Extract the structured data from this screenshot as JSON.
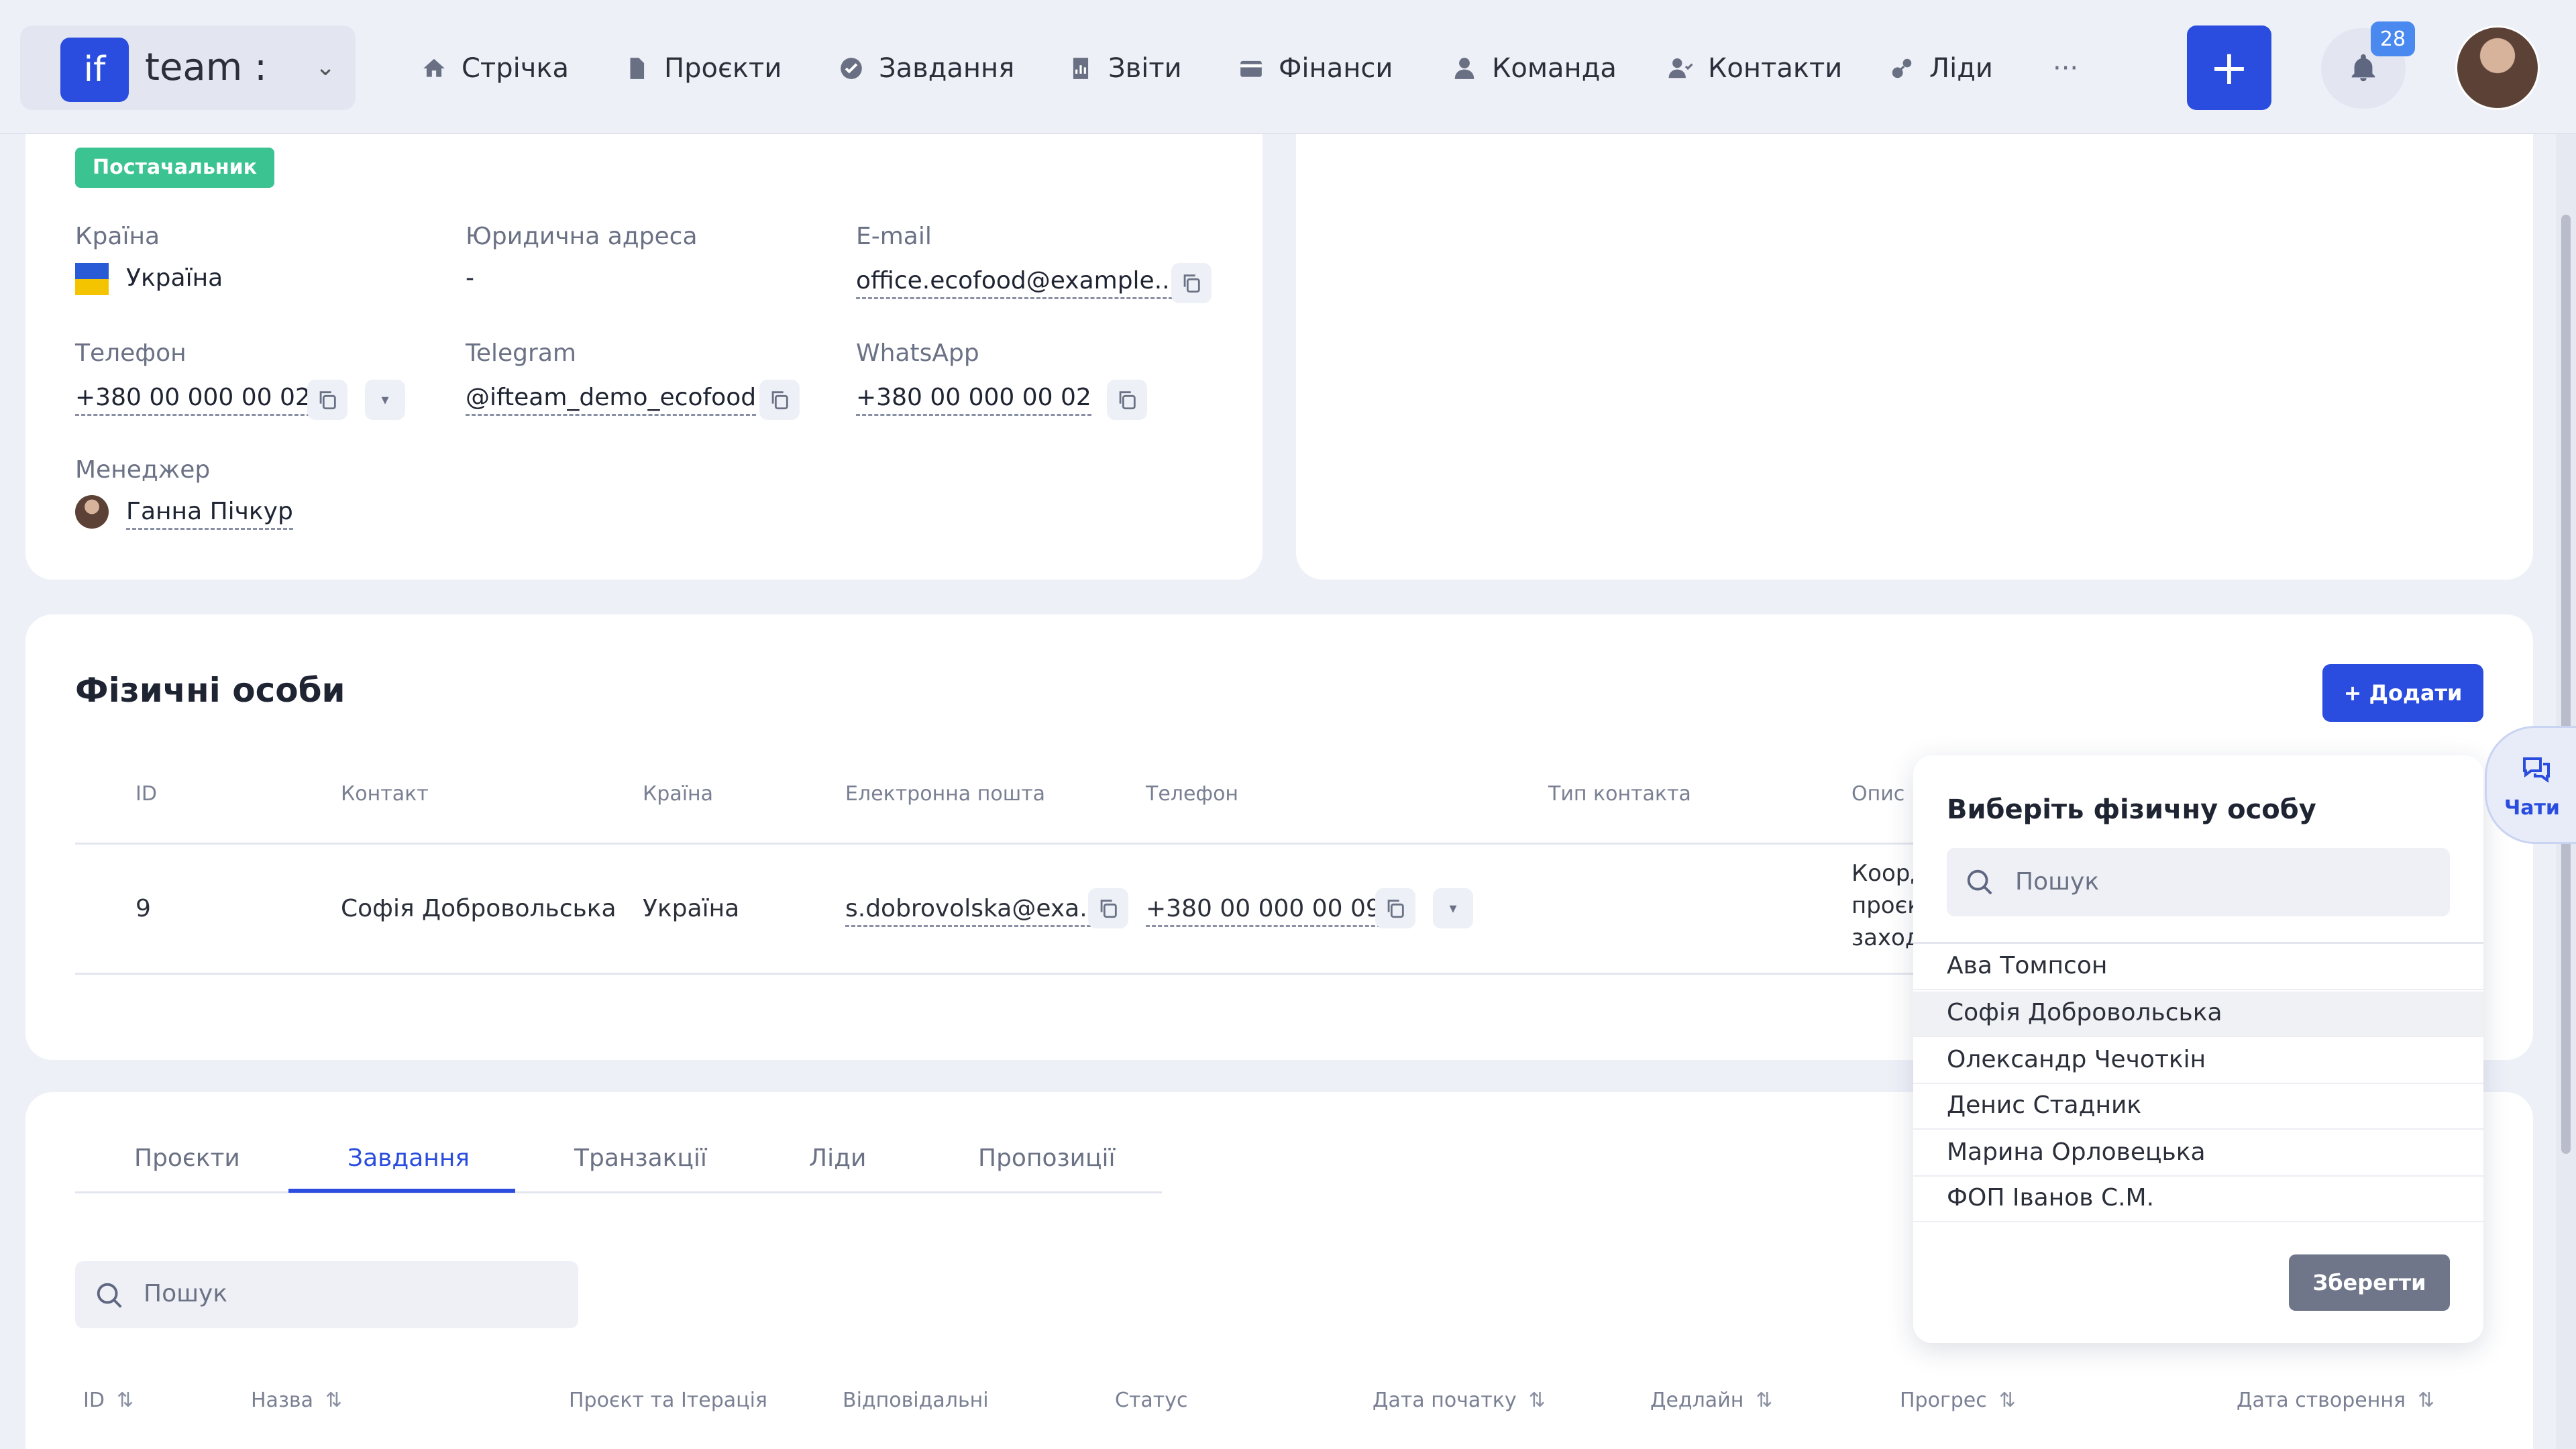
{
  "header": {
    "logo_mark": "if",
    "logo_text": "team :",
    "nav": [
      {
        "label": "Стрічка",
        "icon": "home-icon"
      },
      {
        "label": "Проєкти",
        "icon": "document-icon"
      },
      {
        "label": "Завдання",
        "icon": "check-circle-icon"
      },
      {
        "label": "Звіти",
        "icon": "report-icon"
      },
      {
        "label": "Фінанси",
        "icon": "wallet-icon"
      },
      {
        "label": "Команда",
        "icon": "user-icon"
      },
      {
        "label": "Контакти",
        "icon": "contacts-icon"
      },
      {
        "label": "Ліди",
        "icon": "leads-icon"
      }
    ],
    "more_label": "···",
    "add_label": "+",
    "notifications_count": "28"
  },
  "company": {
    "badge": "Постачальник",
    "country_label": "Країна",
    "country_value": "Україна",
    "legal_address_label": "Юридична адреса",
    "legal_address_value": "-",
    "email_label": "E-mail",
    "email_value": "office.ecofood@example....",
    "phone_label": "Телефон",
    "phone_value": "+380 00 000 00 02",
    "telegram_label": "Telegram",
    "telegram_value": "@ifteam_demo_ecofood",
    "whatsapp_label": "WhatsApp",
    "whatsapp_value": "+380 00 000 00 02",
    "manager_label": "Менеджер",
    "manager_value": "Ганна Пічкур"
  },
  "persons": {
    "title": "Фізичні особи",
    "add_button": "+ Додати",
    "columns": [
      "ID",
      "Контакт",
      "Країна",
      "Електронна пошта",
      "Телефон",
      "Тип контакта",
      "Опис"
    ],
    "row": {
      "id": "9",
      "contact": "Софія Добровольська",
      "country": "Україна",
      "email": "s.dobrovolska@exa...",
      "phone": "+380 00 000 00 09",
      "description": [
        "Коорд",
        "проєк",
        "заход"
      ]
    }
  },
  "chats": {
    "label": "Чати"
  },
  "popup": {
    "title": "Виберіть фізичну особу",
    "search_placeholder": "Пошук",
    "items": [
      "Ава Томпсон",
      "Софія Добровольська",
      "Олександр Чечоткін",
      "Денис Стадник",
      "Марина Орловецька",
      "ФОП Іванов С.М."
    ],
    "highlighted_index": 1,
    "save_button": "Зберегти"
  },
  "tabs": {
    "items": [
      "Проєкти",
      "Завдання",
      "Транзакції",
      "Ліди",
      "Пропозиції"
    ],
    "active_index": 1,
    "search_placeholder": "Пошук"
  },
  "tasks_table": {
    "columns": [
      "ID",
      "Назва",
      "Проєкт та Ітерація",
      "Відповідальні",
      "Статус",
      "Дата початку",
      "Дедлайн",
      "Прогрес",
      "Дата створення"
    ]
  },
  "colors": {
    "accent": "#2a4ddf",
    "badge": "#3cc392",
    "save_button": "#6f7689"
  }
}
